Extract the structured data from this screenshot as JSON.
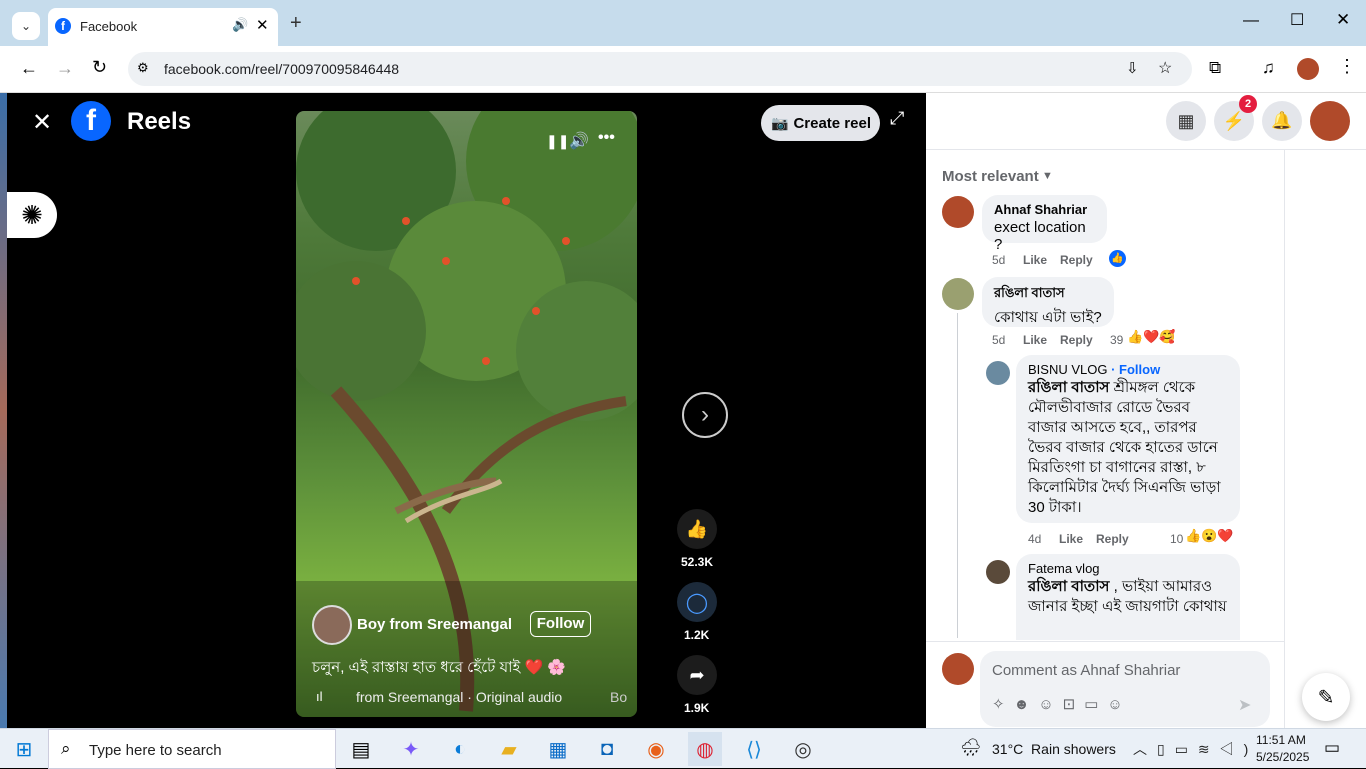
{
  "browser": {
    "tab_title": "Facebook",
    "url": "facebook.com/reel/700970095846448"
  },
  "reels": {
    "title": "Reels",
    "create_label": "Create reel",
    "author": "Boy from Sreemangal",
    "follow_label": "Follow",
    "caption": "চলুন, এই রাস্তায় হাত ধরে হেঁটে যাই ❤️ 🌸",
    "audio": "from Sreemangal · Original audio",
    "audio_trail": "Bo",
    "likes": "52.3K",
    "comments": "1.2K",
    "shares": "1.9K"
  },
  "header": {
    "messenger_badge": "2"
  },
  "comments": {
    "sort_label": "Most relevant",
    "items": [
      {
        "author": "Ahnaf Shahriar",
        "text": "exect location ?",
        "time": "5d",
        "like": "Like",
        "reply": "Reply"
      },
      {
        "author": "রঙিলা বাতাস",
        "text": "কোথায় এটা ভাই?",
        "time": "5d",
        "like": "Like",
        "reply": "Reply",
        "reactions": "39"
      },
      {
        "author": "BISNU VLOG",
        "follow": "· Follow",
        "mention": "রঙিলা বাতাস",
        "text": "শ্রীমঙ্গল থেকে মৌলভীবাজার রোডে ভৈরব বাজার আসতে হবে,, তারপর ভৈরব বাজার থেকে হাতের ডানে মিরতিংগা চা বাগানের রাস্তা, ৮ কিলোমিটার দৈর্ঘ্য সিএনজি ভাড়া 30 টাকা।",
        "time": "4d",
        "like": "Like",
        "reply": "Reply",
        "reactions": "10"
      },
      {
        "author": "Fatema vlog",
        "mention": "রঙিলা বাতাস",
        "text": ", ভাইয়া আমারও জানার ইচ্ছা এই জায়গাটা কোথায়"
      }
    ],
    "input_placeholder": "Comment as Ahnaf Shahriar"
  },
  "taskbar": {
    "search_placeholder": "Type here to search",
    "weather": "31°C  Rain showers",
    "time": "11:51 AM",
    "date": "5/25/2025"
  },
  "colors": {
    "fb_blue": "#0866ff",
    "badge_red": "#e41e3f"
  }
}
